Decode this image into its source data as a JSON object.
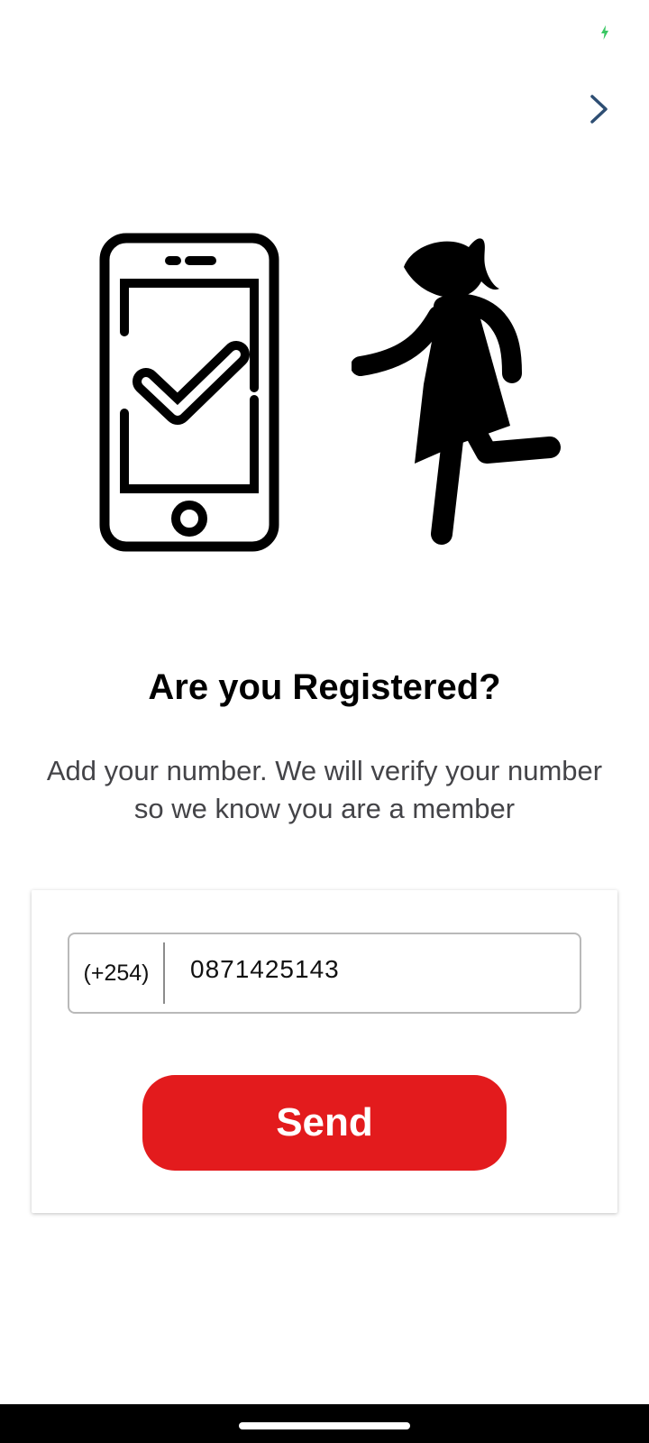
{
  "status_bar": {
    "icon": "charging-icon",
    "icon_color": "#3ac763"
  },
  "header": {
    "next_icon": "chevron-right-icon",
    "next_icon_color": "#2e4e73"
  },
  "illustration": {
    "left_icon": "phone-check-icon",
    "right_icon": "walking-person-icon"
  },
  "title": "Are you Registered?",
  "subtitle": "Add your number. We will verify your number so we know you are a member",
  "form": {
    "country_code": "(+254)",
    "phone_value": "0871425143",
    "send_label": "Send"
  },
  "colors": {
    "accent": "#e31b1d",
    "text": "#000000",
    "subtext": "#444448"
  }
}
